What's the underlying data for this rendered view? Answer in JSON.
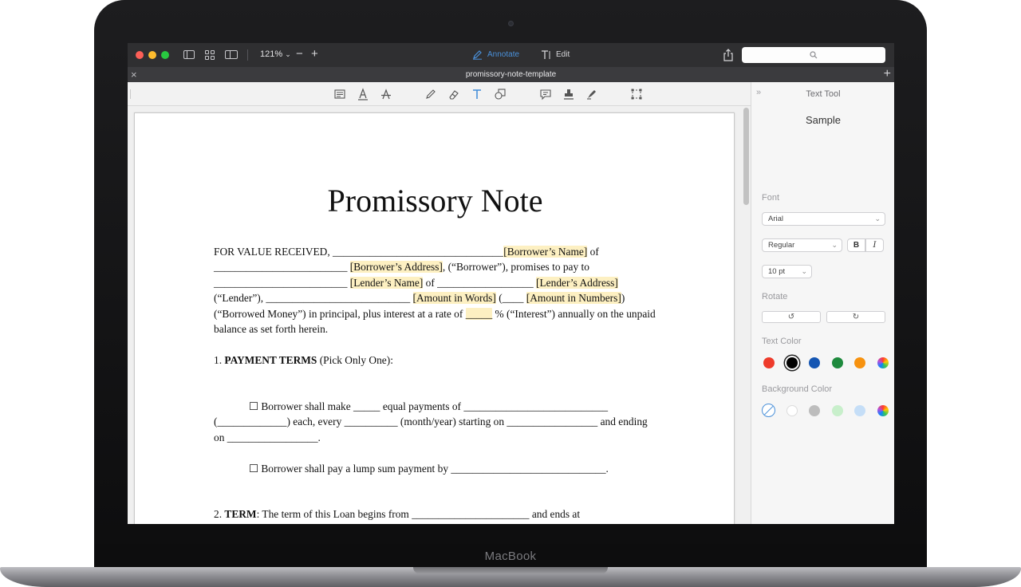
{
  "device": {
    "brand": "MacBook"
  },
  "toolbar": {
    "zoom": "121%",
    "zoom_out": "−",
    "zoom_in": "+",
    "annotate_label": "Annotate",
    "edit_label": "Edit",
    "search_placeholder": ""
  },
  "tab": {
    "title": "promissory-note-template",
    "close": "×",
    "add": "+"
  },
  "document": {
    "title": "Promissory Note",
    "p1": [
      {
        "t": "FOR VALUE RECEIVED, ________________________________"
      },
      {
        "t": "[Borrower’s Name]",
        "hl": true
      },
      {
        "t": " of _________________________ "
      },
      {
        "t": "[Borrower’s Address]",
        "hl": true
      },
      {
        "t": ", (“Borrower”), promises to pay to _________________________ "
      },
      {
        "t": "[Lender’s Name]",
        "hl": true
      },
      {
        "t": " of __________________ "
      },
      {
        "t": "[Lender’s Address]",
        "hl": true
      },
      {
        "t": " (“Lender”), ___________________________ "
      },
      {
        "t": "[Amount in Words]",
        "hl": true
      },
      {
        "t": " (____ "
      },
      {
        "t": "[Amount in Numbers]",
        "hl": true
      },
      {
        "t": ") (“Borrowed Money”) in principal, plus interest at a rate of "
      },
      {
        "t": "_____",
        "hl": true
      },
      {
        "t": " % (“Interest”) annually on the unpaid balance as set forth herein."
      }
    ],
    "section1_num": "1. ",
    "section1_title": "PAYMENT TERMS",
    "section1_rest": " (Pick Only One):",
    "option1": "☐ Borrower shall make _____ equal payments of ___________________________ (_____________) each, every __________ (month/year) starting on _________________ and ending on _________________.",
    "option2": "☐ Borrower shall pay a lump sum payment by _____________________________.",
    "section2_num": "2. ",
    "section2_title": "TERM",
    "section2_rest": ": The term of this Loan begins from ______________________ and ends at"
  },
  "panel": {
    "heading": "Text Tool",
    "sample": "Sample",
    "font_label": "Font",
    "font_value": "Arial",
    "style_value": "Regular",
    "bold": "B",
    "italic": "I",
    "size_value": "10 pt",
    "rotate_label": "Rotate",
    "text_color_label": "Text Color",
    "text_colors": [
      "#ee3b2b",
      "#000000",
      "#1556b3",
      "#1e8a3d",
      "#f7920f"
    ],
    "bg_color_label": "Background Color",
    "bg_colors": [
      "#ffffff",
      "#bdbdbd",
      "#c8efcb",
      "#c5def7"
    ]
  }
}
